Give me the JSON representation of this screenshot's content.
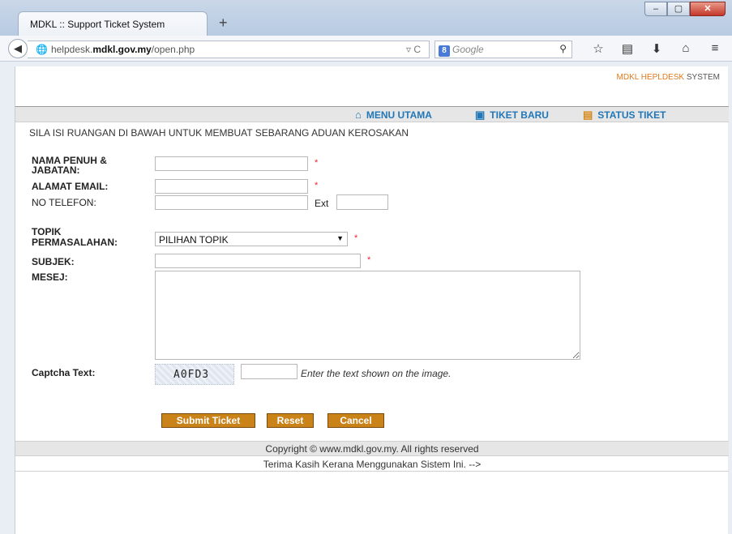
{
  "browser": {
    "tab_title": "MDKL :: Support Ticket System",
    "new_tab": "+",
    "url_domain_prefix": "helpdesk.",
    "url_domain_bold": "mdkl.gov.my",
    "url_path": "/open.php",
    "search_placeholder": "Google",
    "window_buttons": [
      "–",
      "▢",
      "✕"
    ]
  },
  "header": {
    "brand_accent": "MDKL HEPLDESK",
    "brand_rest": " SYSTEM"
  },
  "menu": {
    "items": [
      {
        "label": "MENU UTAMA",
        "icon": "home-icon"
      },
      {
        "label": "TIKET BARU",
        "icon": "new-ticket-icon"
      },
      {
        "label": "STATUS TIKET",
        "icon": "ticket-status-icon"
      }
    ]
  },
  "form": {
    "intro": "SILA ISI RUANGAN DI BAWAH UNTUK MEMBUAT SEBARANG ADUAN KEROSAKAN",
    "name_label_1": "NAMA PENUH &",
    "name_label_2": "JABATAN:",
    "email_label": "ALAMAT EMAIL:",
    "phone_label": "NO TELEFON:",
    "ext_label": "Ext",
    "topic_label_1": "TOPIK",
    "topic_label_2": "PERMASALAHAN:",
    "topic_selected": "PILIHAN TOPIK",
    "subject_label": "SUBJEK:",
    "message_label": "MESEJ:",
    "captcha_label": "Captcha Text:",
    "captcha_code": "A0FD3",
    "captcha_hint": "Enter the text shown on the image.",
    "required_mark": "*"
  },
  "buttons": {
    "submit": "Submit Ticket",
    "reset": "Reset",
    "cancel": "Cancel"
  },
  "footer": {
    "copyright": "Copyright © www.mdkl.gov.my. All rights reserved",
    "thanks": "Terima Kasih Kerana Menggunakan Sistem Ini. -->"
  },
  "colors": {
    "menu_link": "#2277b8",
    "brand_accent": "#e07b1c",
    "button": "#c98319",
    "required": "#ee2233"
  }
}
